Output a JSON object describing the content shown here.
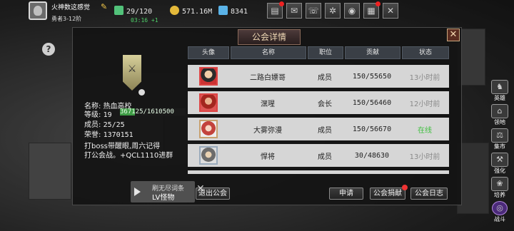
{
  "hud": {
    "player_name": "火神数这感觉",
    "player_rank": "勇者3-12阶",
    "energy": "29/120",
    "energy_timer": "03:16 +1",
    "gold": "571.16M",
    "gems": "8341",
    "icons": [
      "shop-icon",
      "mail-icon",
      "chat-icon",
      "settings-icon",
      "wheel-icon",
      "gift-icon",
      "battle-icon"
    ],
    "accent_color": "#4fd36a"
  },
  "panel": {
    "title": "公会详情",
    "close": "✕"
  },
  "guild": {
    "name_label": "名称:",
    "name": "热血高校",
    "level_label": "等级:",
    "level": "19",
    "level_exp": "367125/1610500",
    "level_progress": 0.228,
    "members_label": "成员:",
    "members": "25/25",
    "honor_label": "荣誉:",
    "honor": "1370151",
    "notice_line1": "打boss带醒眼,周六记得",
    "notice_line2": "打公会战。+QCL1110进群"
  },
  "table": {
    "headers": [
      "头像",
      "名称",
      "职位",
      "贡献",
      "状态"
    ],
    "rows": [
      {
        "avatar": "warrior-avatar-icon",
        "name": "二路白嫖哥",
        "role": "成员",
        "contribution": "150/55650",
        "status": "13小时前",
        "online": false
      },
      {
        "avatar": "red-warrior-avatar-icon",
        "name": "潶瑆",
        "role": "会长",
        "contribution": "150/56460",
        "status": "12小时前",
        "online": false
      },
      {
        "avatar": "red-hair-avatar-icon",
        "name": "大雾弥漫",
        "role": "成员",
        "contribution": "150/56670",
        "status": "在线",
        "online": true
      },
      {
        "avatar": "silver-hair-avatar-icon",
        "name": "悍将",
        "role": "成员",
        "contribution": "30/48630",
        "status": "13小时前",
        "online": false
      }
    ],
    "online_color": "#3fbf3f",
    "offline_color": "#8a8a8a"
  },
  "buttons": {
    "exit": "退出公会",
    "apply": "申请",
    "donate": "公会捐献",
    "log": "公会日志"
  },
  "notice": {
    "line1": "刷无尽词条",
    "line2": "LV怪物"
  },
  "side_menu": [
    {
      "icon": "hero-icon",
      "label": "英雄"
    },
    {
      "icon": "territory-icon",
      "label": "领地"
    },
    {
      "icon": "market-icon",
      "label": "集市"
    },
    {
      "icon": "enhance-icon",
      "label": "强化"
    },
    {
      "icon": "cultivate-icon",
      "label": "培养"
    },
    {
      "icon": "fight-icon",
      "label": "战斗"
    }
  ]
}
